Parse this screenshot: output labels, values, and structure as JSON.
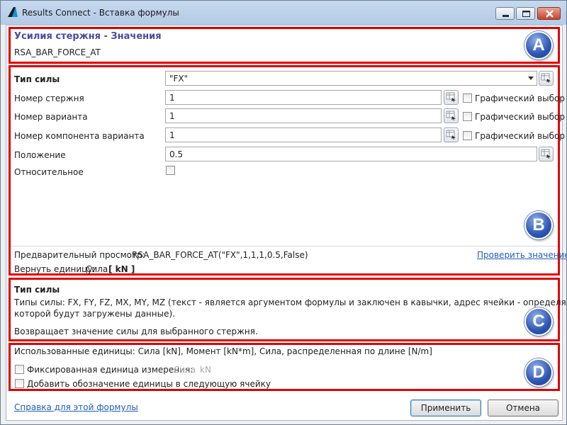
{
  "window": {
    "title": "Results Connect - Вставка формулы"
  },
  "header": {
    "title": "Усилия стержня - Значения",
    "function_name": "RSA_BAR_FORCE_AT"
  },
  "badges": {
    "a": "A",
    "b": "B",
    "c": "C",
    "d": "D"
  },
  "form": {
    "force_type": {
      "label": "Тип силы",
      "value": "\"FX\""
    },
    "bar_number": {
      "label": "Номер стержня",
      "value": "1",
      "graphic_label": "Графический выбор"
    },
    "case_number": {
      "label": "Номер варианта",
      "value": "1",
      "graphic_label": "Графический выбор"
    },
    "component_number": {
      "label": "Номер компонента варианта",
      "value": "1",
      "graphic_label": "Графический выбор"
    },
    "position": {
      "label": "Положение",
      "value": "0.5"
    },
    "relative": {
      "label": "Относительное",
      "checked": false
    },
    "preview": {
      "label": "Предварительный просмотр:",
      "value": "RSA_BAR_FORCE_AT(\"FX\",1,1,1,0.5,False)",
      "check_link": "Проверить значение"
    },
    "return_unit": {
      "label": "Вернуть единицу:",
      "name": "Сила",
      "value": "[ kN ]"
    }
  },
  "help": {
    "title": "Тип силы",
    "line1": "Типы силы: FX, FY, FZ, MX, MY, MZ (текст - является аргументом формулы и заключен в кавычки, адрес ячейки - определяет ячейку, из",
    "line2": "которой будут загружены данные).",
    "returns": "Возвращает значение силы для выбранного стержня."
  },
  "units": {
    "used": "Использованные единицы:  Сила [kN], Момент [kN*m], Сила, распределенная по длине [N/m]",
    "fixed_unit": {
      "label": "Фиксированная единица измерения:",
      "name": "Сила",
      "value": "kN",
      "checked": false
    },
    "add_unit": {
      "label": "Добавить обозначение единицы в следующую ячейку",
      "checked": false
    }
  },
  "footer": {
    "help_link": "Справка для этой формулы",
    "apply": "Применить",
    "cancel": "Отмена"
  },
  "colors": {
    "highlight": "#e00000",
    "accent": "#4a4aa0",
    "link": "#1f5fbf",
    "badge": "#2d55b3"
  },
  "icons": {
    "app": "autodesk-logo-icon",
    "pick": "cell-picker-icon",
    "dropdown": "chevron-down-icon"
  }
}
